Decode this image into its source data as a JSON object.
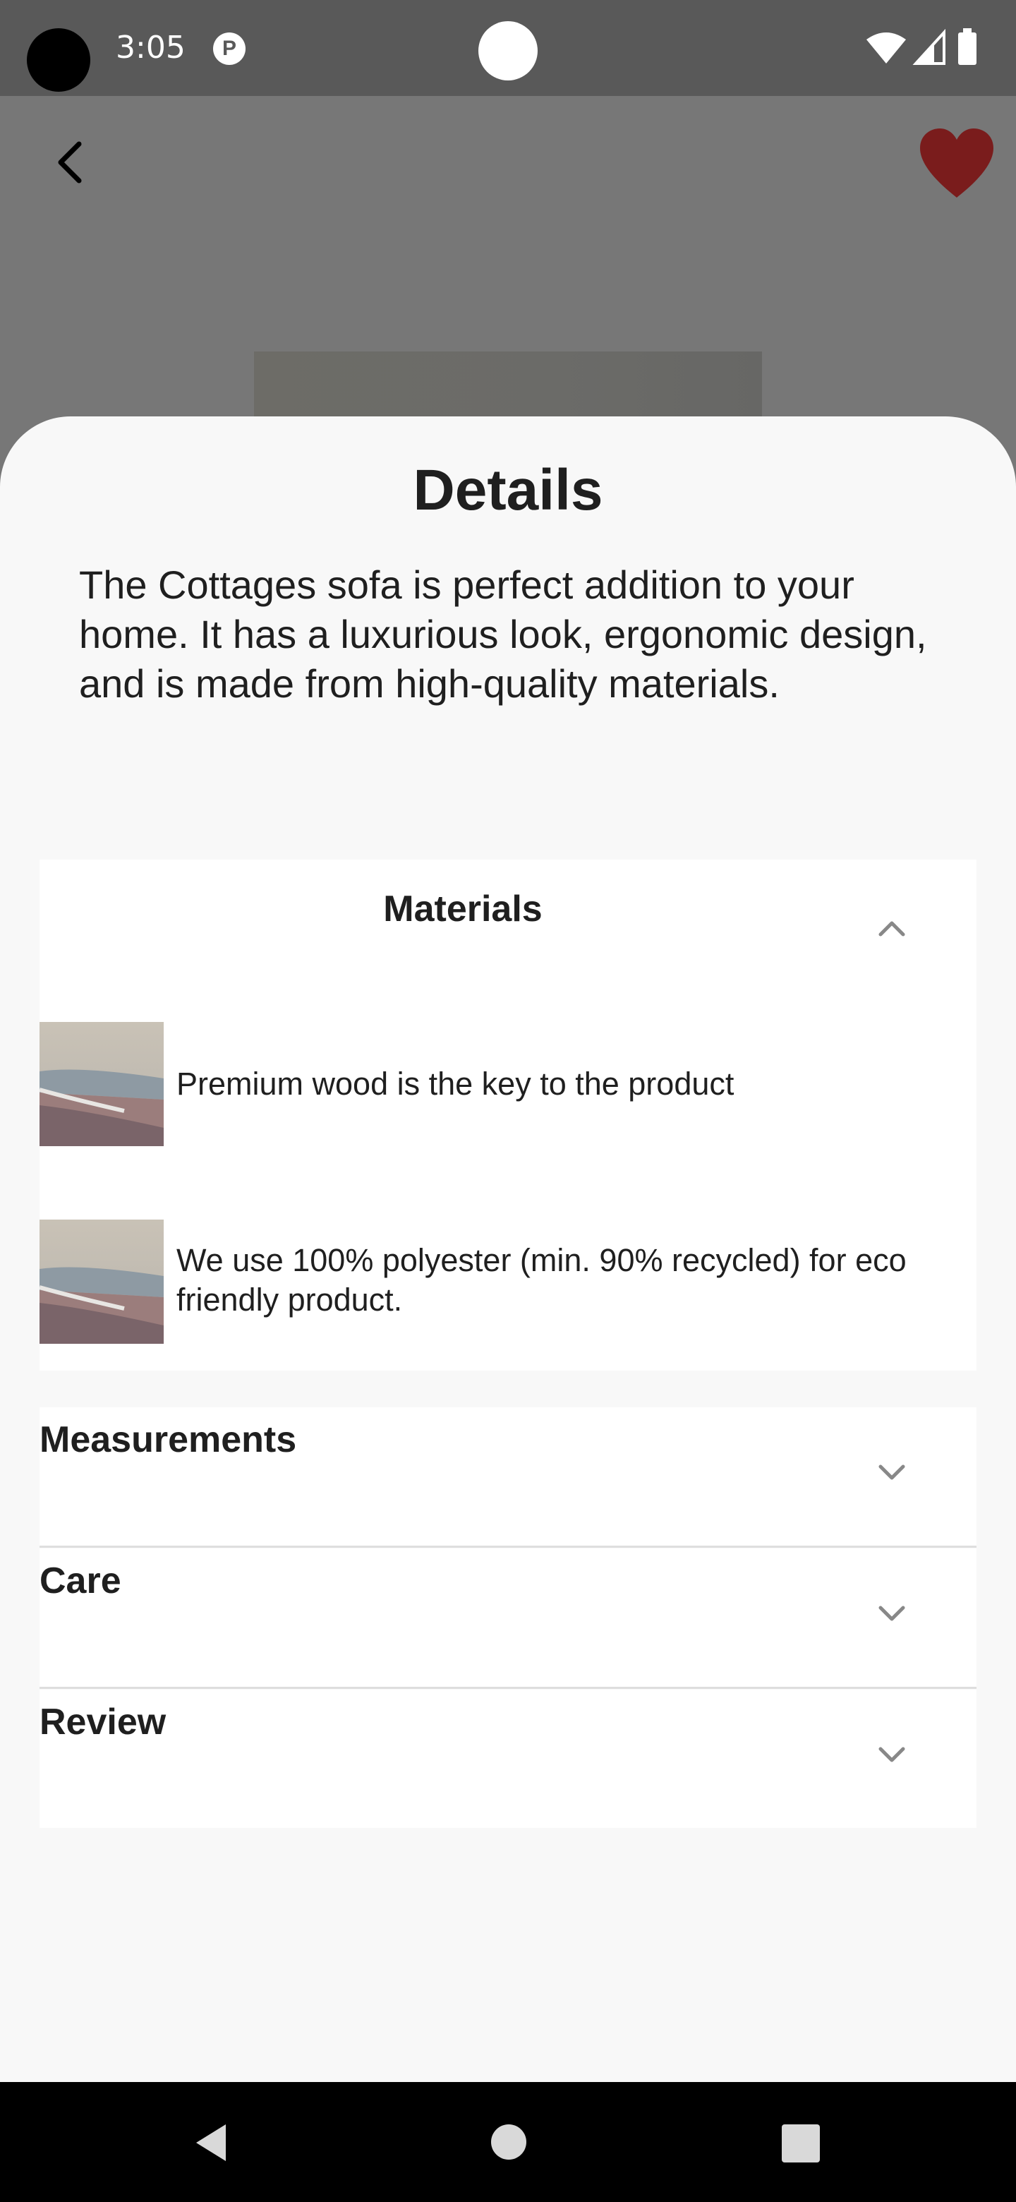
{
  "status_bar": {
    "time": "3:05",
    "notification_icon": "p-circle-icon",
    "icons": [
      "wifi-icon",
      "signal-icon",
      "battery-icon"
    ]
  },
  "header": {
    "back_icon": "back-arrow-icon",
    "favorite_icon": "heart-icon",
    "favorite_color": "#7a1c1c"
  },
  "sheet": {
    "title": "Details",
    "description": "The Cottages sofa is perfect addition to your home. It has a luxurious look, ergonomic design, and is made from high-quality materials.",
    "materials": {
      "title": "Materials",
      "expanded": true,
      "items": [
        {
          "text": "Premium wood is the key to the product"
        },
        {
          "text": "We use 100% polyester (min. 90% recycled) for eco friendly product."
        }
      ]
    },
    "sections": [
      {
        "title": "Measurements",
        "expanded": false
      },
      {
        "title": "Care",
        "expanded": false
      },
      {
        "title": "Review",
        "expanded": false
      }
    ]
  },
  "nav_bar": {
    "icons": [
      "nav-back-icon",
      "nav-home-icon",
      "nav-recents-icon"
    ]
  }
}
